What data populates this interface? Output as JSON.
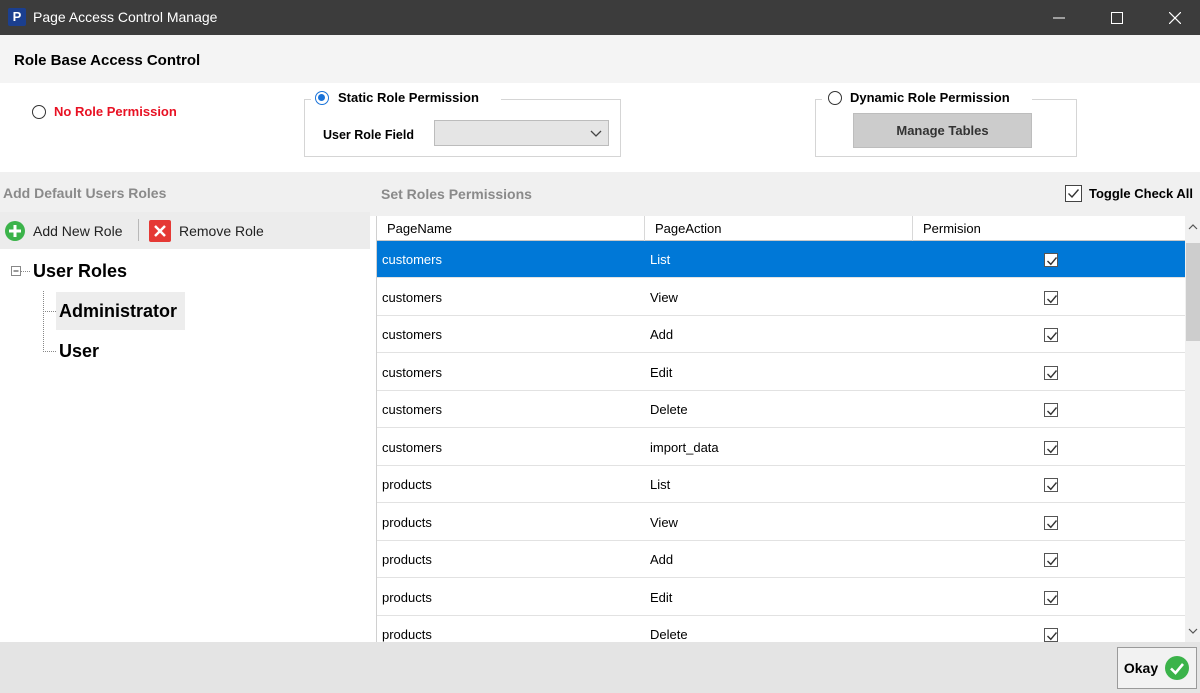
{
  "window": {
    "app_icon_letter": "P",
    "title": "Page Access Control Manage"
  },
  "header": {
    "title": "Role Base Access Control"
  },
  "permission_modes": {
    "no_role": {
      "label": "No Role Permission",
      "selected": false,
      "color": "#e81123"
    },
    "static_role": {
      "label": "Static Role Permission",
      "selected": true,
      "field_label": "User Role Field",
      "field_value": ""
    },
    "dynamic_role": {
      "label": "Dynamic Role Permission",
      "selected": false,
      "button_label": "Manage Tables"
    }
  },
  "roles_panel": {
    "title": "Add Default Users Roles",
    "add_label": "Add New Role",
    "remove_label": "Remove Role",
    "tree": {
      "root": "User Roles",
      "children": [
        "Administrator",
        "User"
      ],
      "selected": "Administrator"
    }
  },
  "permissions_panel": {
    "title": "Set Roles Permissions",
    "toggle_label": "Toggle Check All",
    "toggle_checked": true,
    "columns": [
      "PageName",
      "PageAction",
      "Permision"
    ],
    "rows": [
      {
        "page": "customers",
        "action": "List",
        "checked": true
      },
      {
        "page": "customers",
        "action": "View",
        "checked": true
      },
      {
        "page": "customers",
        "action": "Add",
        "checked": true
      },
      {
        "page": "customers",
        "action": "Edit",
        "checked": true
      },
      {
        "page": "customers",
        "action": "Delete",
        "checked": true
      },
      {
        "page": "customers",
        "action": "import_data",
        "checked": true
      },
      {
        "page": "products",
        "action": "List",
        "checked": true
      },
      {
        "page": "products",
        "action": "View",
        "checked": true
      },
      {
        "page": "products",
        "action": "Add",
        "checked": true
      },
      {
        "page": "products",
        "action": "Edit",
        "checked": true
      },
      {
        "page": "products",
        "action": "Delete",
        "checked": true
      }
    ],
    "selected_row": 0,
    "selection_color": "#0078d7"
  },
  "footer": {
    "okay_label": "Okay",
    "okay_icon_color": "#3bb34a"
  }
}
